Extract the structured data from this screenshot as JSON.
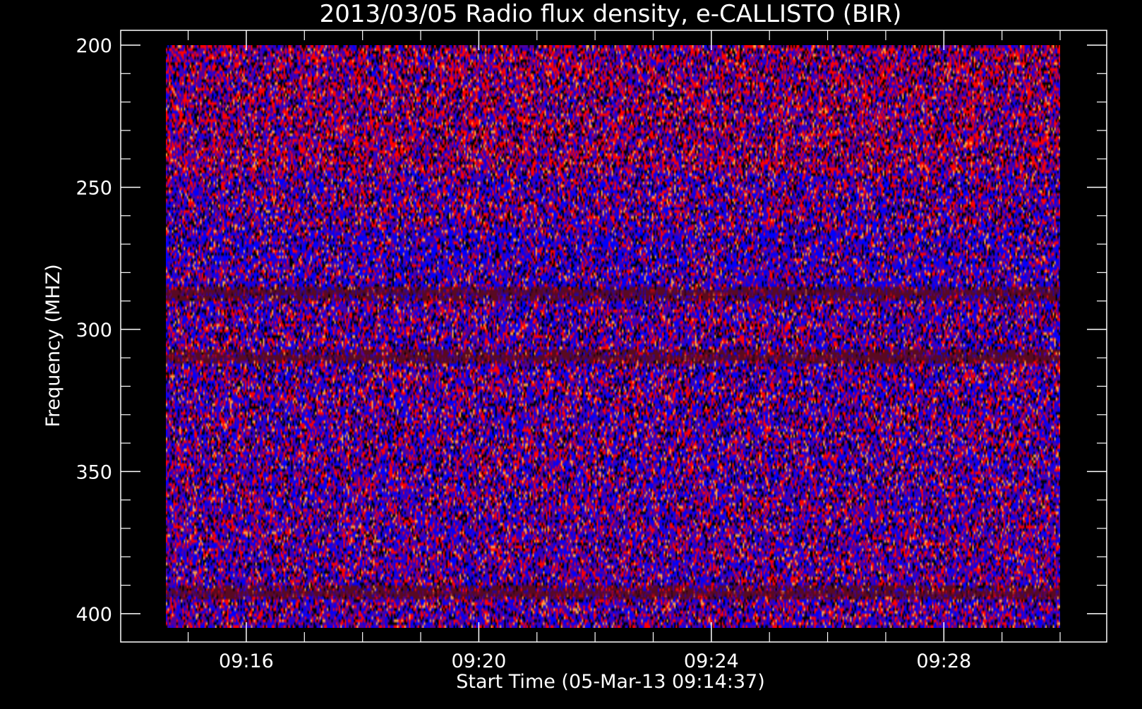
{
  "chart_data": {
    "type": "heatmap",
    "title": "2013/03/05  Radio flux density, e-CALLISTO (BIR)",
    "xlabel": "Start Time (05-Mar-13 09:14:37)",
    "ylabel": "Frequency (MHZ)",
    "x_start": "09:14:37",
    "xlim": [
      "09:14:37",
      "09:30:00"
    ],
    "ylim": [
      200,
      405
    ],
    "y_axis_reversed": true,
    "x_ticks": [
      "09:16",
      "09:20",
      "09:24",
      "09:28"
    ],
    "y_ticks": [
      200,
      250,
      300,
      350,
      400
    ],
    "colorscale": [
      "#000000",
      "#5000a0",
      "#0000ff",
      "#ff0000",
      "#ffa040"
    ],
    "background": "#000000",
    "axis_color": "#ffffff",
    "horizontal_bands_mhz": [
      287,
      310,
      393
    ],
    "grid": false,
    "legend": "none"
  }
}
